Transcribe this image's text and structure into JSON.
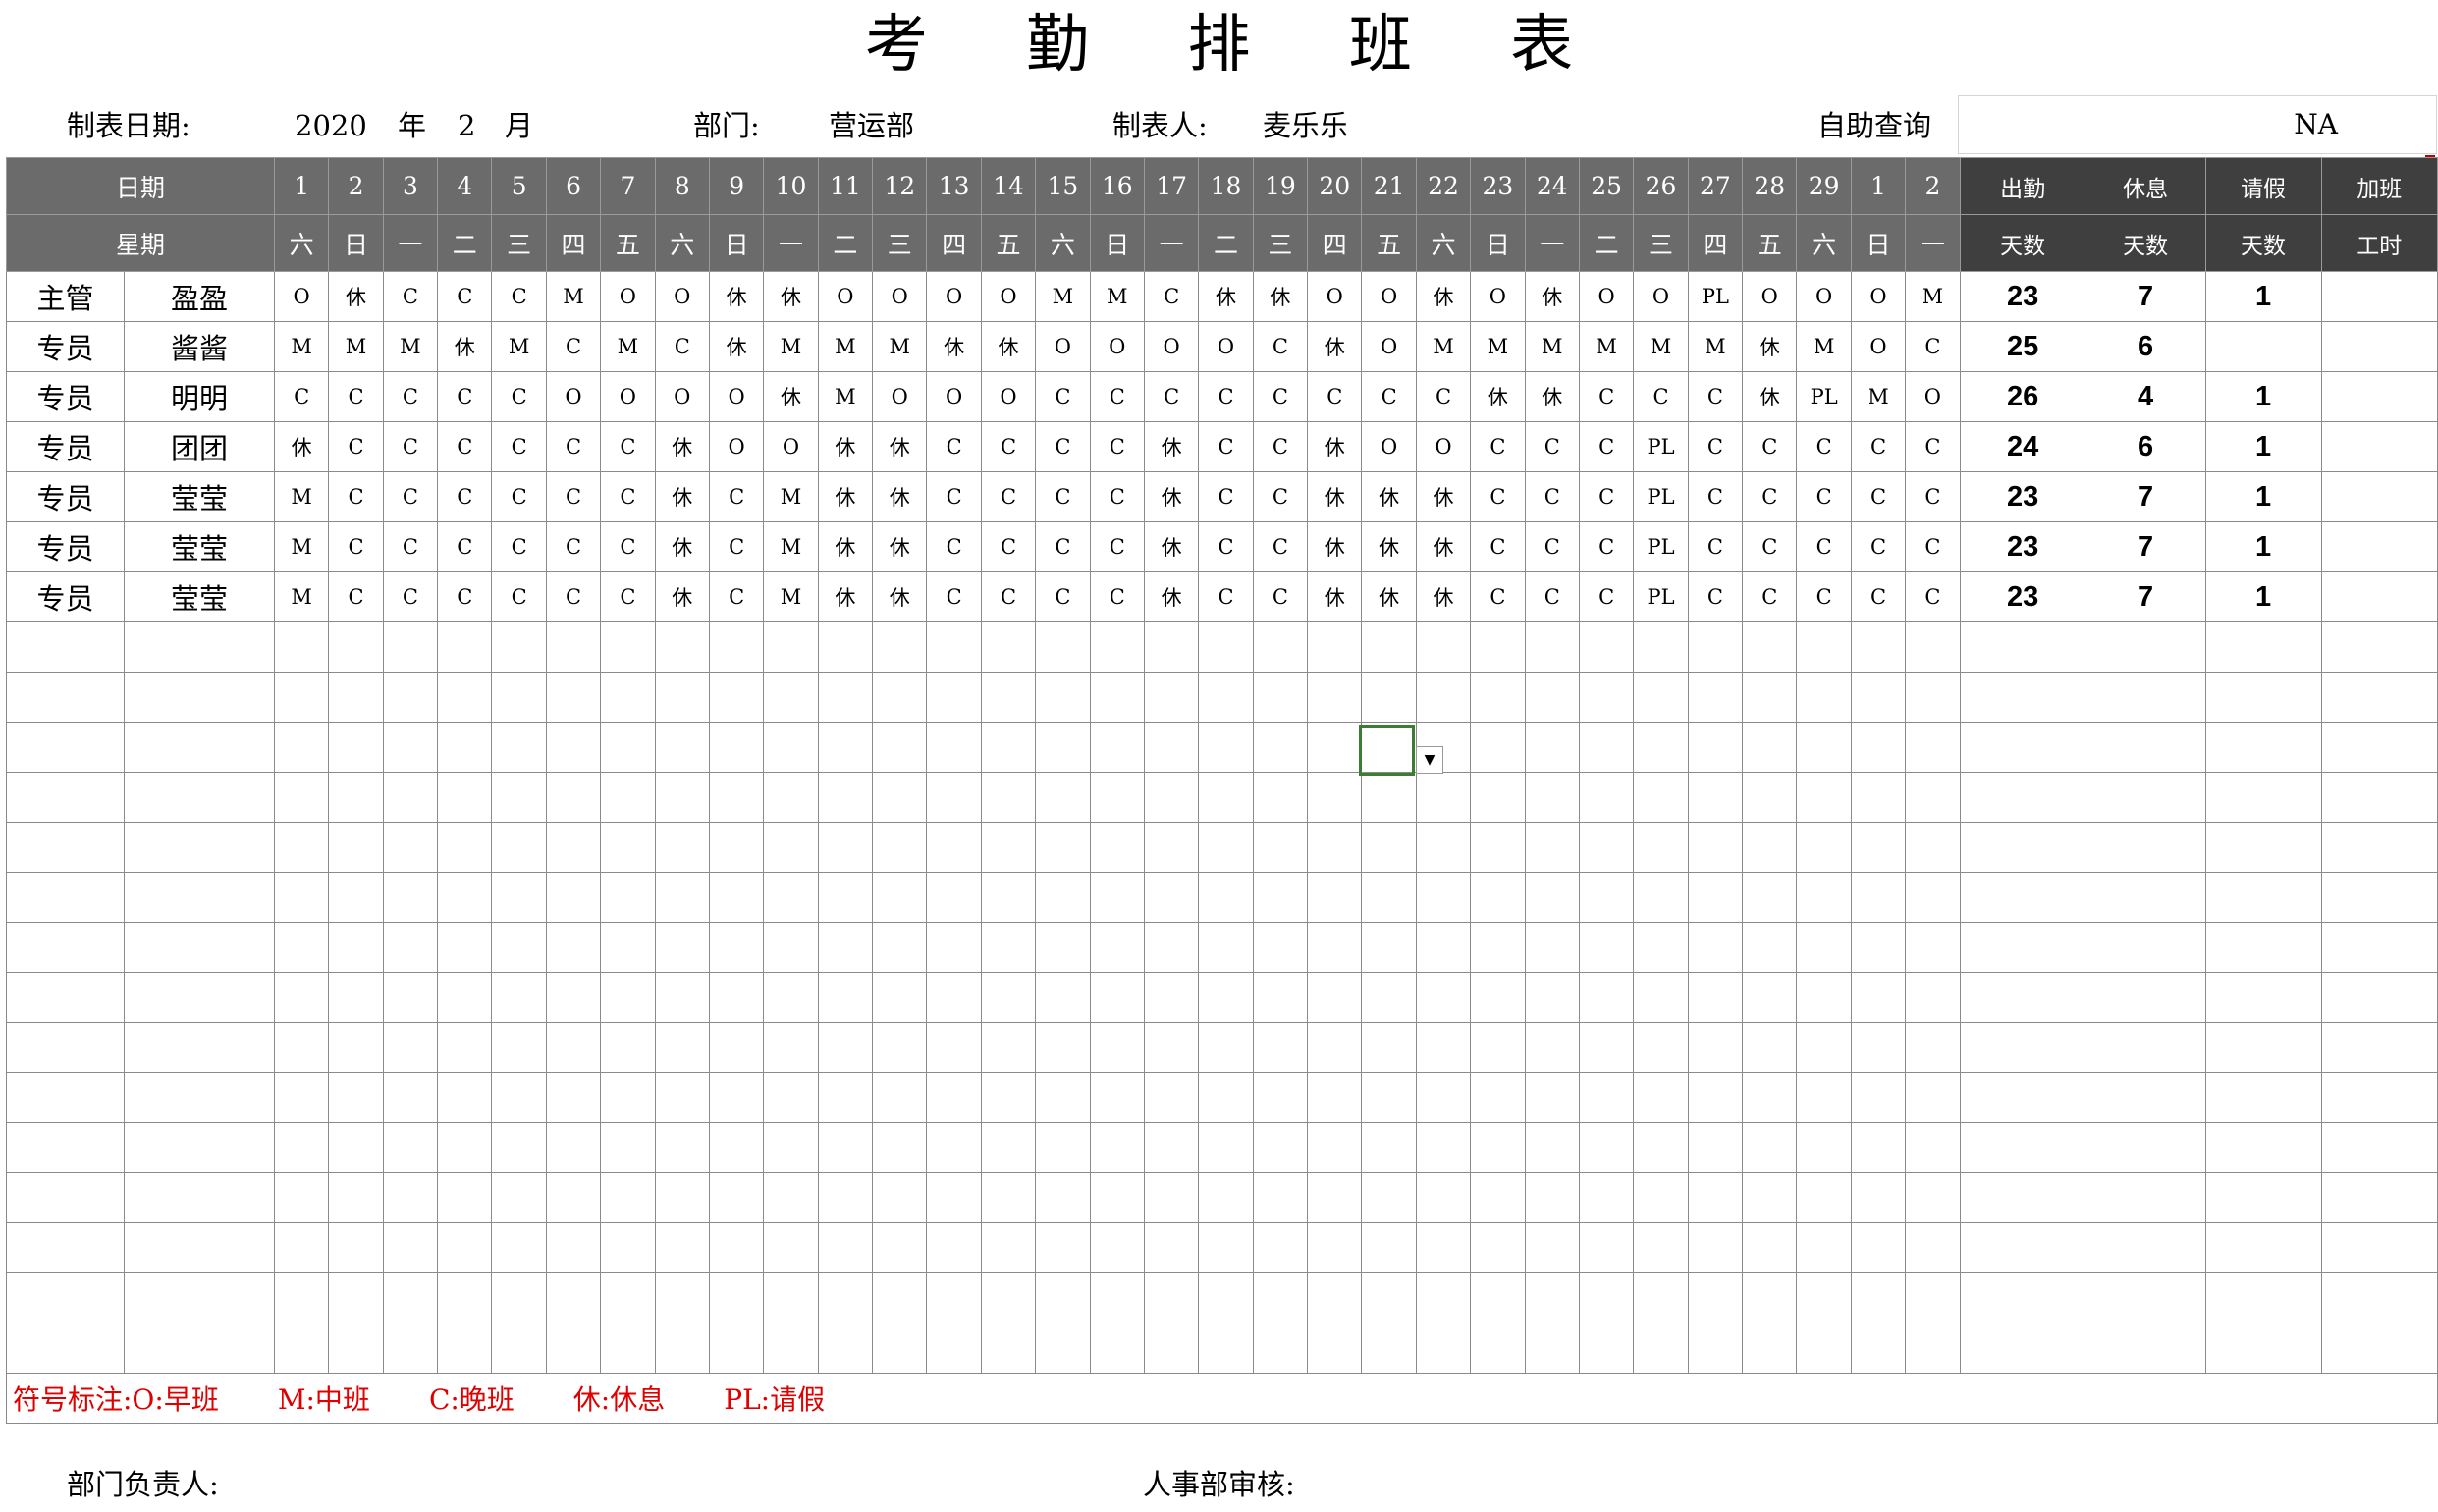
{
  "title": "考 勤 排 班 表",
  "meta": {
    "date_label": "制表日期:",
    "year": "2020",
    "year_unit": "年",
    "month": "2",
    "month_unit": "月",
    "dept_label": "部门:",
    "dept_value": "营运部",
    "maker_label": "制表人:",
    "maker_value": "麦乐乐",
    "query_label": "自助查询",
    "query_value": "NA"
  },
  "header": {
    "date_label": "日期",
    "week_label": "星期",
    "days": [
      "1",
      "2",
      "3",
      "4",
      "5",
      "6",
      "7",
      "8",
      "9",
      "10",
      "11",
      "12",
      "13",
      "14",
      "15",
      "16",
      "17",
      "18",
      "19",
      "20",
      "21",
      "22",
      "23",
      "24",
      "25",
      "26",
      "27",
      "28",
      "29",
      "1",
      "2"
    ],
    "weekdays": [
      "六",
      "日",
      "一",
      "二",
      "三",
      "四",
      "五",
      "六",
      "日",
      "一",
      "二",
      "三",
      "四",
      "五",
      "六",
      "日",
      "一",
      "二",
      "三",
      "四",
      "五",
      "六",
      "日",
      "一",
      "二",
      "三",
      "四",
      "五",
      "六",
      "日",
      "一"
    ],
    "summary_top": [
      "出勤",
      "休息",
      "请假",
      "加班"
    ],
    "summary_bottom": [
      "天数",
      "天数",
      "天数",
      "工时"
    ]
  },
  "rows": [
    {
      "role": "主管",
      "name": "盈盈",
      "shifts": [
        "O",
        "休",
        "C",
        "C",
        "C",
        "M",
        "O",
        "O",
        "休",
        "休",
        "O",
        "O",
        "O",
        "O",
        "M",
        "M",
        "C",
        "休",
        "休",
        "O",
        "O",
        "休",
        "O",
        "休",
        "O",
        "O",
        "PL",
        "O",
        "O",
        "O",
        "M"
      ],
      "attend": "23",
      "rest": "7",
      "leave": "1",
      "overtime": ""
    },
    {
      "role": "专员",
      "name": "酱酱",
      "shifts": [
        "M",
        "M",
        "M",
        "休",
        "M",
        "C",
        "M",
        "C",
        "休",
        "M",
        "M",
        "M",
        "休",
        "休",
        "O",
        "O",
        "O",
        "O",
        "C",
        "休",
        "O",
        "M",
        "M",
        "M",
        "M",
        "M",
        "M",
        "休",
        "M",
        "O",
        "C"
      ],
      "attend": "25",
      "rest": "6",
      "leave": "",
      "overtime": ""
    },
    {
      "role": "专员",
      "name": "明明",
      "shifts": [
        "C",
        "C",
        "C",
        "C",
        "C",
        "O",
        "O",
        "O",
        "O",
        "休",
        "M",
        "O",
        "O",
        "O",
        "C",
        "C",
        "C",
        "C",
        "C",
        "C",
        "C",
        "C",
        "休",
        "休",
        "C",
        "C",
        "C",
        "休",
        "PL",
        "M",
        "O"
      ],
      "attend": "26",
      "rest": "4",
      "leave": "1",
      "overtime": ""
    },
    {
      "role": "专员",
      "name": "团团",
      "shifts": [
        "休",
        "C",
        "C",
        "C",
        "C",
        "C",
        "C",
        "休",
        "O",
        "O",
        "休",
        "休",
        "C",
        "C",
        "C",
        "C",
        "休",
        "C",
        "C",
        "休",
        "O",
        "O",
        "C",
        "C",
        "C",
        "PL",
        "C",
        "C",
        "C",
        "C",
        "C"
      ],
      "attend": "24",
      "rest": "6",
      "leave": "1",
      "overtime": ""
    },
    {
      "role": "专员",
      "name": "莹莹",
      "shifts": [
        "M",
        "C",
        "C",
        "C",
        "C",
        "C",
        "C",
        "休",
        "C",
        "M",
        "休",
        "休",
        "C",
        "C",
        "C",
        "C",
        "休",
        "C",
        "C",
        "休",
        "休",
        "休",
        "C",
        "C",
        "C",
        "PL",
        "C",
        "C",
        "C",
        "C",
        "C"
      ],
      "attend": "23",
      "rest": "7",
      "leave": "1",
      "overtime": ""
    },
    {
      "role": "专员",
      "name": "莹莹",
      "shifts": [
        "M",
        "C",
        "C",
        "C",
        "C",
        "C",
        "C",
        "休",
        "C",
        "M",
        "休",
        "休",
        "C",
        "C",
        "C",
        "C",
        "休",
        "C",
        "C",
        "休",
        "休",
        "休",
        "C",
        "C",
        "C",
        "PL",
        "C",
        "C",
        "C",
        "C",
        "C"
      ],
      "attend": "23",
      "rest": "7",
      "leave": "1",
      "overtime": ""
    },
    {
      "role": "专员",
      "name": "莹莹",
      "shifts": [
        "M",
        "C",
        "C",
        "C",
        "C",
        "C",
        "C",
        "休",
        "C",
        "M",
        "休",
        "休",
        "C",
        "C",
        "C",
        "C",
        "休",
        "C",
        "C",
        "休",
        "休",
        "休",
        "C",
        "C",
        "C",
        "PL",
        "C",
        "C",
        "C",
        "C",
        "C"
      ],
      "attend": "23",
      "rest": "7",
      "leave": "1",
      "overtime": ""
    }
  ],
  "legend": [
    "符号标注:O:早班",
    "M:中班",
    "C:晚班",
    "休:休息",
    "PL:请假"
  ],
  "footer": {
    "dept_head": "部门负责人:",
    "hr_review": "人事部审核:"
  }
}
